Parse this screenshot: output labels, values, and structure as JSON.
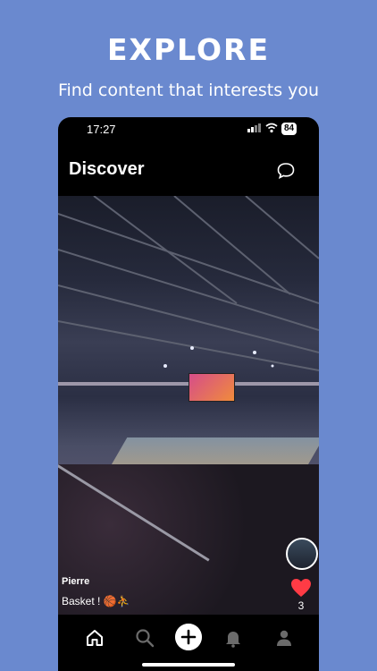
{
  "promo": {
    "headline": "EXPLORE",
    "subhead": "Find content that interests you"
  },
  "status_bar": {
    "time": "17:27",
    "battery": "84"
  },
  "app_bar": {
    "title": "Discover",
    "message_icon": "chat-bubble-icon"
  },
  "post": {
    "username": "Pierre",
    "caption": "Basket ! 🏀⛹️",
    "like_count": "3",
    "liked": true
  },
  "bottom_nav": {
    "items": [
      {
        "icon": "home-icon",
        "active": true
      },
      {
        "icon": "search-icon",
        "active": false
      },
      {
        "icon": "add-icon",
        "active": false
      },
      {
        "icon": "bell-icon",
        "active": false
      },
      {
        "icon": "profile-icon",
        "active": false
      }
    ]
  },
  "colors": {
    "background": "#6a89cf",
    "like": "#ff3b45"
  }
}
